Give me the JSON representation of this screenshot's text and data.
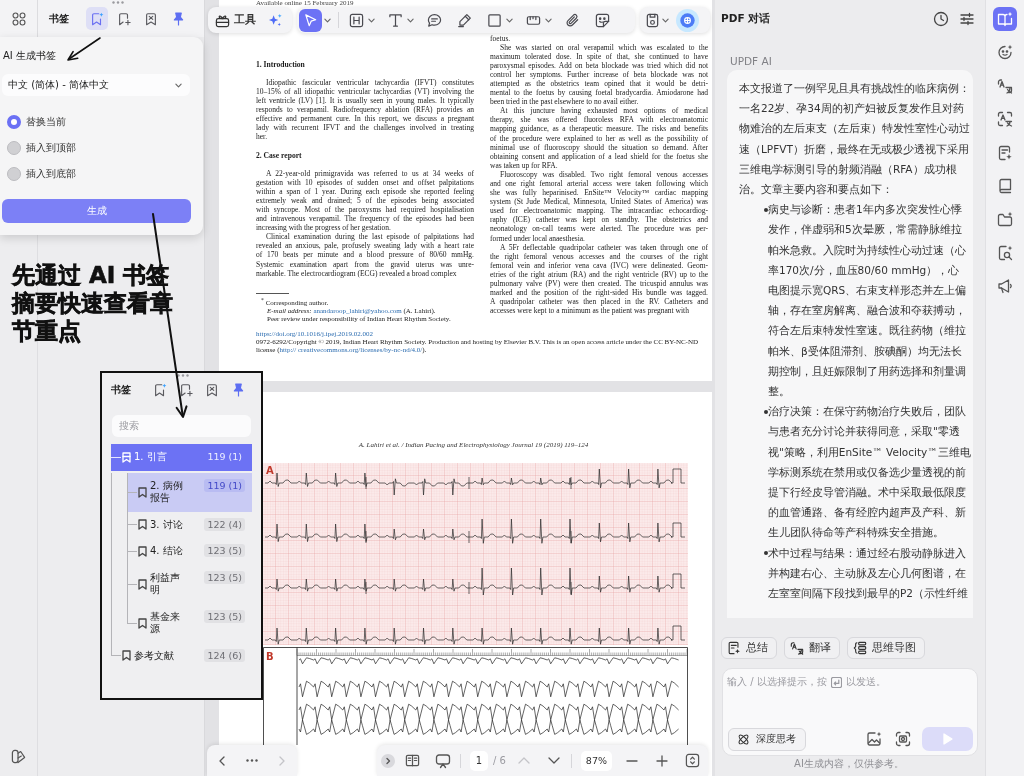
{
  "left_panel": {
    "title": "书签",
    "tools": [
      {
        "selected": true
      },
      {
        "selected": false
      },
      {
        "selected": false
      }
    ],
    "pinned": true,
    "popup": {
      "title": "AI 生成书签",
      "language": "中文 (简体) - 简体中文",
      "options": [
        {
          "label": "替换当前",
          "selected": true
        },
        {
          "label": "插入到顶部",
          "selected": false
        },
        {
          "label": "插入到底部",
          "selected": false
        }
      ],
      "button": "生成"
    }
  },
  "annotation": {
    "text": "先通过 AI 书签摘要快速查看章节重点"
  },
  "inset": {
    "title": "书签",
    "tools": [
      {
        "selected": false
      },
      {
        "selected": false
      },
      {
        "selected": false
      }
    ],
    "pinned": true,
    "search": {
      "placeholder": "搜索"
    },
    "bookmarks": [
      {
        "label": "1. 引言",
        "page": "119 (1)",
        "selected": true,
        "hovered": false,
        "expanded": true,
        "children": [
          {
            "label": "2. 病例报告",
            "page": "119 (1)",
            "selected": false,
            "hovered": true
          },
          {
            "label": "3. 讨论",
            "page": "122 (4)",
            "selected": false,
            "hovered": false
          },
          {
            "label": "4. 结论",
            "page": "123 (5)",
            "selected": false,
            "hovered": false
          },
          {
            "label": "利益声明",
            "page": "123 (5)",
            "selected": false,
            "hovered": false
          },
          {
            "label": "基金来源",
            "page": "123 (5)",
            "selected": false,
            "hovered": false
          }
        ]
      },
      {
        "label": "参考文献",
        "page": "124 (6)",
        "selected": false,
        "hovered": false,
        "expanded": false
      }
    ]
  },
  "toolbar": {
    "tools_label": "工具",
    "tools": [
      {
        "selected": true,
        "menu": true
      },
      {
        "selected": false,
        "menu": true
      },
      {
        "selected": false,
        "menu": true
      },
      {
        "selected": false,
        "menu": false
      },
      {
        "selected": false,
        "menu": false
      },
      {
        "selected": false,
        "menu": true
      },
      {
        "selected": false,
        "menu": true
      },
      {
        "selected": false,
        "menu": false
      },
      {
        "selected": false,
        "menu": false
      }
    ],
    "save_menu": true
  },
  "document": {
    "page_1": {
      "dateline": "Available online 15 February 2019",
      "left_column": [
        {
          "kind": "heading",
          "text": "1. Introduction"
        },
        {
          "kind": "paragraph",
          "continued": false,
          "lines": [
            "Idiopathic fascicular ventricular tachycardia (IFVT) constitutes",
            "10–15% of all idiopathic ventricular tachycardias (VT) involving the",
            "left ventricle (LV) [1]. It is usually seen in young males. It typically",
            "responds to verapamil. Radiofrequency ablation (RFA) provides an",
            "effective and permanent cure. In this report, we discuss a pregnant",
            "lady with recurrent IFVT and the challenges involved in treating",
            "her."
          ]
        },
        {
          "kind": "heading",
          "text": "2. Case report"
        },
        {
          "kind": "paragraph",
          "continued": false,
          "lines": [
            "A 22-year-old primigravida was referred to us at 34 weeks of",
            "gestation with 10 episodes of sudden onset and offset palpitations",
            "within a span of 1 year. During each episode she reported feeling",
            "extremely weak and drained; 5 of the episodes being associated",
            "with syncope. Most of the paroxysms had required hospitalisation",
            "and intravenous verapamil. The frequency of the episodes had been",
            "increasing with the progress of her gestation."
          ]
        },
        {
          "kind": "paragraph",
          "continued": false,
          "lines": [
            "Clinical examination during the last episode of palpitations had",
            "revealed an anxious, pale, profusely sweating lady with a heart rate",
            "of 170 beats per minute and a blood pressure of 80/60 mmHg.",
            "Systemic examination apart from the gravid uterus was unre-",
            "markable. The electrocardiogram (ECG) revealed a broad complex"
          ]
        }
      ],
      "footnotes": {
        "author": "$^{*}$ Corresponding author.",
        "email_label": "E-mail address:",
        "email": "anandaroop_lahiri@yahoo.com",
        "email_after": "(A. Lahiri).",
        "review": "Peer review under responsibility of Indian Heart Rhythm Society."
      },
      "right_column": [
        {
          "kind": "paragraph",
          "continued": true,
          "lines": [
            "foetus."
          ]
        },
        {
          "kind": "paragraph",
          "continued": false,
          "lines": [
            "She was started on oral verapamil which was escalated to the",
            "maximum tolerated dose. In spite of that, she continued to have",
            "paroxysmal episodes. Add on beta blockade was tried which did not",
            "control her symptoms. Further increase of beta blockade was not",
            "attempted as the obstetrics team opined that it would be detri-",
            "mental to the foetus by causing foetal bradycardia. Amiodarone had",
            "been tried in the past elsewhere to no avail either."
          ]
        },
        {
          "kind": "paragraph",
          "continued": false,
          "lines": [
            "At this juncture having exhausted most options of medical",
            "therapy, she was offered fluoroless RFA with electroanatomic",
            "mapping guidance, as a therapeutic measure. The risks and benefits",
            "of the procedure were explained to her as well as the possibility of",
            "minimal use of fluoroscopy should the situation so demand. After",
            "obtaining consent and application of a lead shield for the foetus she",
            "was taken up for RFA."
          ]
        },
        {
          "kind": "paragraph",
          "continued": false,
          "lines": [
            "Fluoroscopy was disabled. Two right femoral venous accesses",
            "and one right femoral arterial access were taken following which",
            "she was fully heparinised. EnSite™ Velocity™ cardiac mapping",
            "system (St Jude Medical, Minnesota, United States of America) was",
            "used for electroanatomic mapping. The intracardiac echocardiog-",
            "raphy (ICE) catheter was kept on standby. The obstetrics and",
            "neonatology on-call teams were alerted. The procedure was per-",
            "formed under local anaesthesia."
          ]
        },
        {
          "kind": "paragraph",
          "continued": false,
          "lines": [
            "A 5Fr deflectable quadripolar catheter was taken through one of",
            "the right femoral venous accesses and the courses of the right",
            "femoral vein and inferior vena cava (IVC) were delineated. Geom-",
            "etries of the right atrium (RA) and the right ventricle (RV) up to the",
            "pulmonary valve (PV) were then created. The tricuspid annulus was",
            "marked and the position of the right-sided His bundle was tagged.",
            "A quadripolar catheter was then placed in the RV. Catheters and",
            "accesses were kept to a minimum as the patient was pregnant with"
          ]
        }
      ],
      "doi": "https://doi.org/10.1016/j.ipej.2019.02.002",
      "copyright": {
        "text": "0972-6292/Copyright © 2019, Indian Heart Rhythm Society. Production and hosting by Elsevier B.V. This is an open access article under the CC BY-NC-ND license (",
        "link_start": "http://",
        "link_end": "creativecommons.org/licenses/by-nc-nd/4.0/",
        "end": ")."
      }
    },
    "page_2": {
      "running_head": "A. Lahiri et al. / Indian Pacing and Electrophysiology Journal 19 (2019) 119–124",
      "figure_panels": [
        {
          "kind": "grid",
          "label": "A"
        },
        {
          "kind": "strip",
          "label": "B"
        }
      ]
    }
  },
  "page_nav": {
    "back_disabled": false,
    "forward_disabled": true
  },
  "viewer_bar": {
    "page": "1",
    "total": "/ 6",
    "prev_disabled": true,
    "next_disabled": false,
    "zoom": "87%"
  },
  "chat": {
    "title": "PDF 对话",
    "sender": "UPDF AI",
    "intro": [
      "本文报道了一例罕见且具有挑战性的临床病例：",
      "一名22岁、孕34周的初产妇被反复发作且对药",
      "物难治的左后束支（左后束）特发性室性心动过",
      "速（LPFVT）折磨，最终在无或极少透视下采用",
      "三维电学标测引导的射频消融（RFA）成功根",
      "治。文章主要内容和要点如下："
    ],
    "bullets": [
      {
        "lines": [
          "病史与诊断：患者1年内多次突发性心悸",
          "发作，伴虚弱和5次晕厥，常需静脉维拉",
          "帕米急救。入院时为持续性心动过速（心",
          "率170次/分，血压80/60 mmHg），心",
          "电图提示宽QRS、右束支样形态并左上偏",
          "轴，存在室房解离、融合波和夺获搏动，",
          "符合左后束特发性室速。既往药物（维拉",
          "帕米、β受体阻滞剂、胺碘酮）均无法长",
          "期控制，且妊娠限制了用药选择和剂量调",
          "整。"
        ]
      },
      {
        "lines": [
          "治疗决策：在保守药物治疗失败后，团队",
          "与患者充分讨论并获得同意，采取\"零透",
          "视\"策略，利用EnSite™ Velocity™三维电",
          "学标测系统在禁用或仅备选少量透视的前",
          "提下行经皮导管消融。术中采取最低限度",
          "的血管通路、备有经腔内超声及产科、新",
          "生儿团队待命等产科特殊安全措施。"
        ]
      },
      {
        "lines": [
          "术中过程与结果：通过经右股动静脉进入",
          "并构建右心、主动脉及左心几何图谱，在",
          "左室室间隔下段找到最早的P2（示性纤维"
        ]
      }
    ],
    "quick_actions": [
      {
        "label": "总结"
      },
      {
        "label": "翻译"
      },
      {
        "label": "思维导图"
      }
    ],
    "input": {
      "placeholder": "输入 / 以选择提示，按",
      "placeholder_end": "以发送。"
    },
    "deep_think": "深度思考",
    "send_disabled": true,
    "disclaimer": "AI生成内容，仅供参考。"
  },
  "rail": [
    {
      "selected": true
    },
    {
      "selected": false
    },
    {
      "selected": false
    },
    {
      "selected": false
    },
    {
      "selected": false
    },
    {
      "selected": false
    },
    {
      "selected": false
    },
    {
      "selected": false
    },
    {
      "selected": false
    }
  ]
}
